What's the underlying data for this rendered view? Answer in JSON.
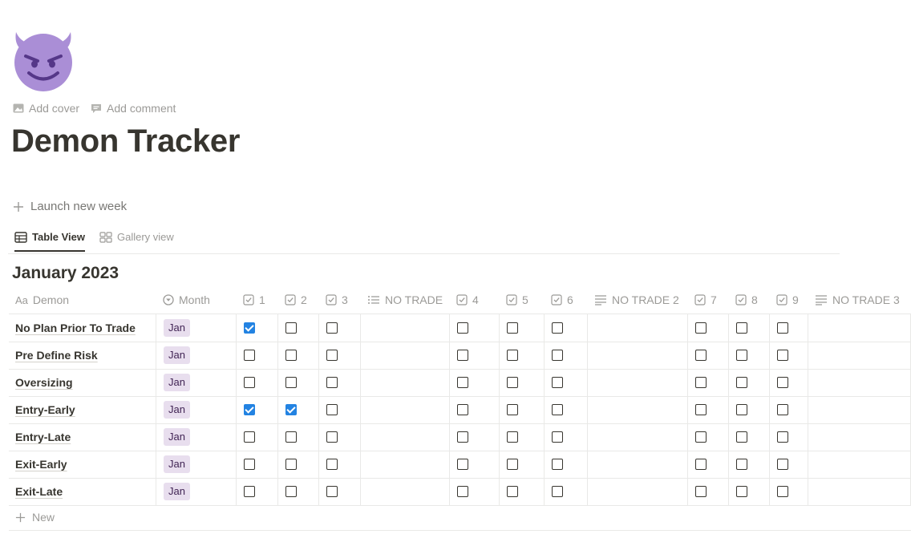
{
  "page": {
    "icon": "smiling-devil-emoji",
    "add_cover": "Add cover",
    "add_comment": "Add comment",
    "title": "Demon Tracker",
    "launch_button": "Launch new week"
  },
  "tabs": [
    {
      "label": "Table View",
      "icon": "table-icon",
      "active": true
    },
    {
      "label": "Gallery view",
      "icon": "gallery-icon",
      "active": false
    }
  ],
  "group": {
    "title": "January 2023"
  },
  "columns": [
    {
      "label": "Demon",
      "icon": "title-icon"
    },
    {
      "label": "Month",
      "icon": "select-icon"
    },
    {
      "label": "1",
      "icon": "checkbox-icon"
    },
    {
      "label": "2",
      "icon": "checkbox-icon"
    },
    {
      "label": "3",
      "icon": "checkbox-icon"
    },
    {
      "label": "NO TRADE",
      "icon": "list-icon"
    },
    {
      "label": "4",
      "icon": "checkbox-icon"
    },
    {
      "label": "5",
      "icon": "checkbox-icon"
    },
    {
      "label": "6",
      "icon": "checkbox-icon"
    },
    {
      "label": "NO TRADE 2",
      "icon": "text-icon"
    },
    {
      "label": "7",
      "icon": "checkbox-icon"
    },
    {
      "label": "8",
      "icon": "checkbox-icon"
    },
    {
      "label": "9",
      "icon": "checkbox-icon"
    },
    {
      "label": "NO TRADE 3",
      "icon": "text-icon"
    }
  ],
  "rows": [
    {
      "demon": "No Plan Prior To Trade",
      "month": "Jan",
      "checks": [
        true,
        false,
        false,
        false,
        false,
        false,
        false,
        false,
        false
      ]
    },
    {
      "demon": "Pre Define Risk",
      "month": "Jan",
      "checks": [
        false,
        false,
        false,
        false,
        false,
        false,
        false,
        false,
        false
      ]
    },
    {
      "demon": "Oversizing",
      "month": "Jan",
      "checks": [
        false,
        false,
        false,
        false,
        false,
        false,
        false,
        false,
        false
      ]
    },
    {
      "demon": "Entry-Early",
      "month": "Jan",
      "checks": [
        true,
        true,
        false,
        false,
        false,
        false,
        false,
        false,
        false
      ]
    },
    {
      "demon": "Entry-Late",
      "month": "Jan",
      "checks": [
        false,
        false,
        false,
        false,
        false,
        false,
        false,
        false,
        false
      ]
    },
    {
      "demon": "Exit-Early",
      "month": "Jan",
      "checks": [
        false,
        false,
        false,
        false,
        false,
        false,
        false,
        false,
        false
      ]
    },
    {
      "demon": "Exit-Late",
      "month": "Jan",
      "checks": [
        false,
        false,
        false,
        false,
        false,
        false,
        false,
        false,
        false
      ]
    }
  ],
  "new_row_label": "New",
  "colors": {
    "accent": "#2383e2",
    "tag_bg": "#e8deee",
    "tag_text": "#412454"
  }
}
